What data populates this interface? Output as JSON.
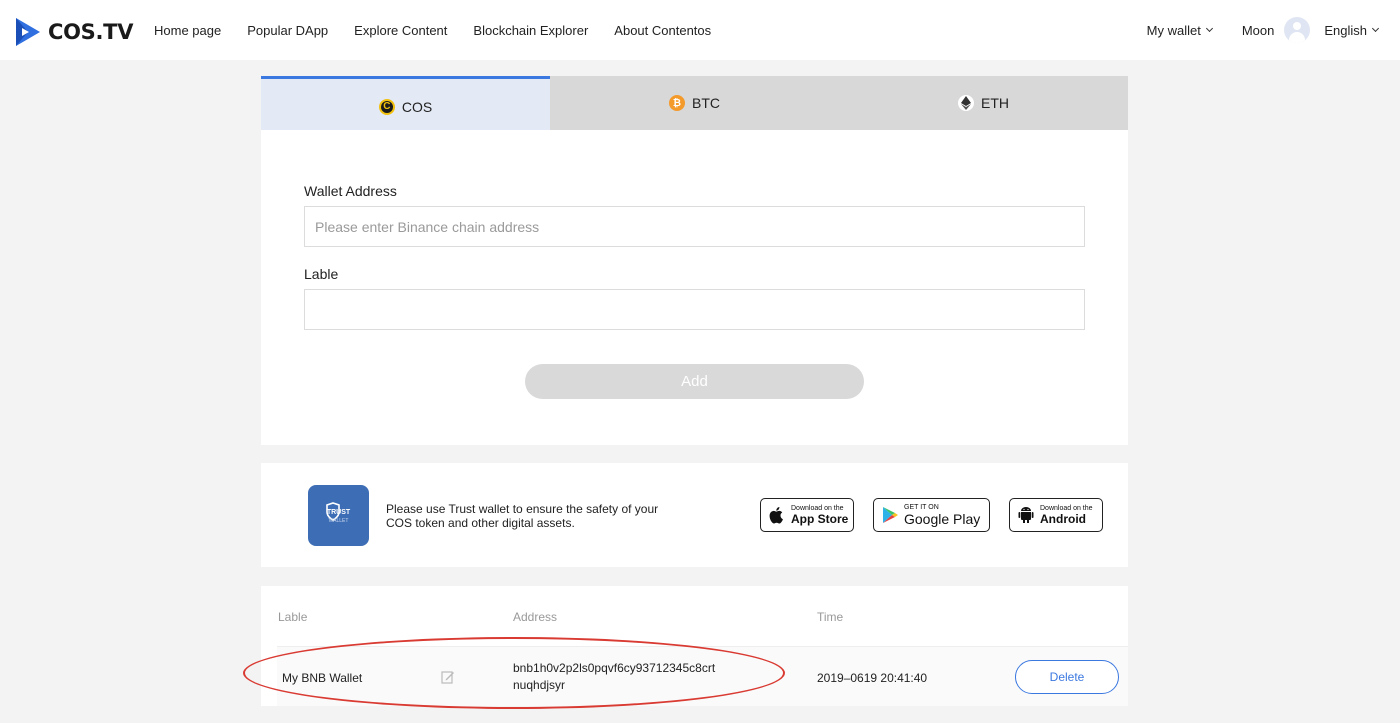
{
  "header": {
    "logo_text": "COS.TV",
    "nav": [
      "Home page",
      "Popular DApp",
      "Explore Content",
      "Blockchain Explorer",
      "About Contentos"
    ],
    "my_wallet": "My wallet",
    "user_name": "Moon",
    "language": "English"
  },
  "tabs": [
    {
      "label": "COS",
      "icon": "cos-coin-icon",
      "active": true
    },
    {
      "label": "BTC",
      "icon": "btc-coin-icon",
      "active": false
    },
    {
      "label": "ETH",
      "icon": "eth-coin-icon",
      "active": false
    }
  ],
  "form": {
    "wallet_address_label": "Wallet Address",
    "wallet_address_placeholder": "Please enter Binance chain address",
    "wallet_address_value": "",
    "label_label": "Lable",
    "label_value": "",
    "add_button": "Add"
  },
  "trust": {
    "logo_title": "TRUST",
    "logo_sub": "WALLET",
    "message": "Please use Trust wallet to ensure the safety of your COS token and other digital assets.",
    "stores": [
      {
        "small": "Download on the",
        "big": "App Store",
        "icon": "apple-icon"
      },
      {
        "small": "GET IT ON",
        "big": "Google Play",
        "icon": "google-play-icon"
      },
      {
        "small": "Download on the",
        "big": "Android",
        "icon": "android-icon"
      }
    ]
  },
  "table": {
    "headers": [
      "Lable",
      "Address",
      "Time"
    ],
    "rows": [
      {
        "label": "My BNB Wallet",
        "address_line1": "bnb1h0v2p2ls0pqvf6cy93712345c8crt",
        "address_line2": "nuqhdjsyr",
        "time": "2019–0619 20:41:40",
        "delete": "Delete"
      }
    ]
  },
  "colors": {
    "accent": "#3b78e0",
    "highlight_ellipse": "#d93a32",
    "trust_blue": "#3d6eb5"
  }
}
